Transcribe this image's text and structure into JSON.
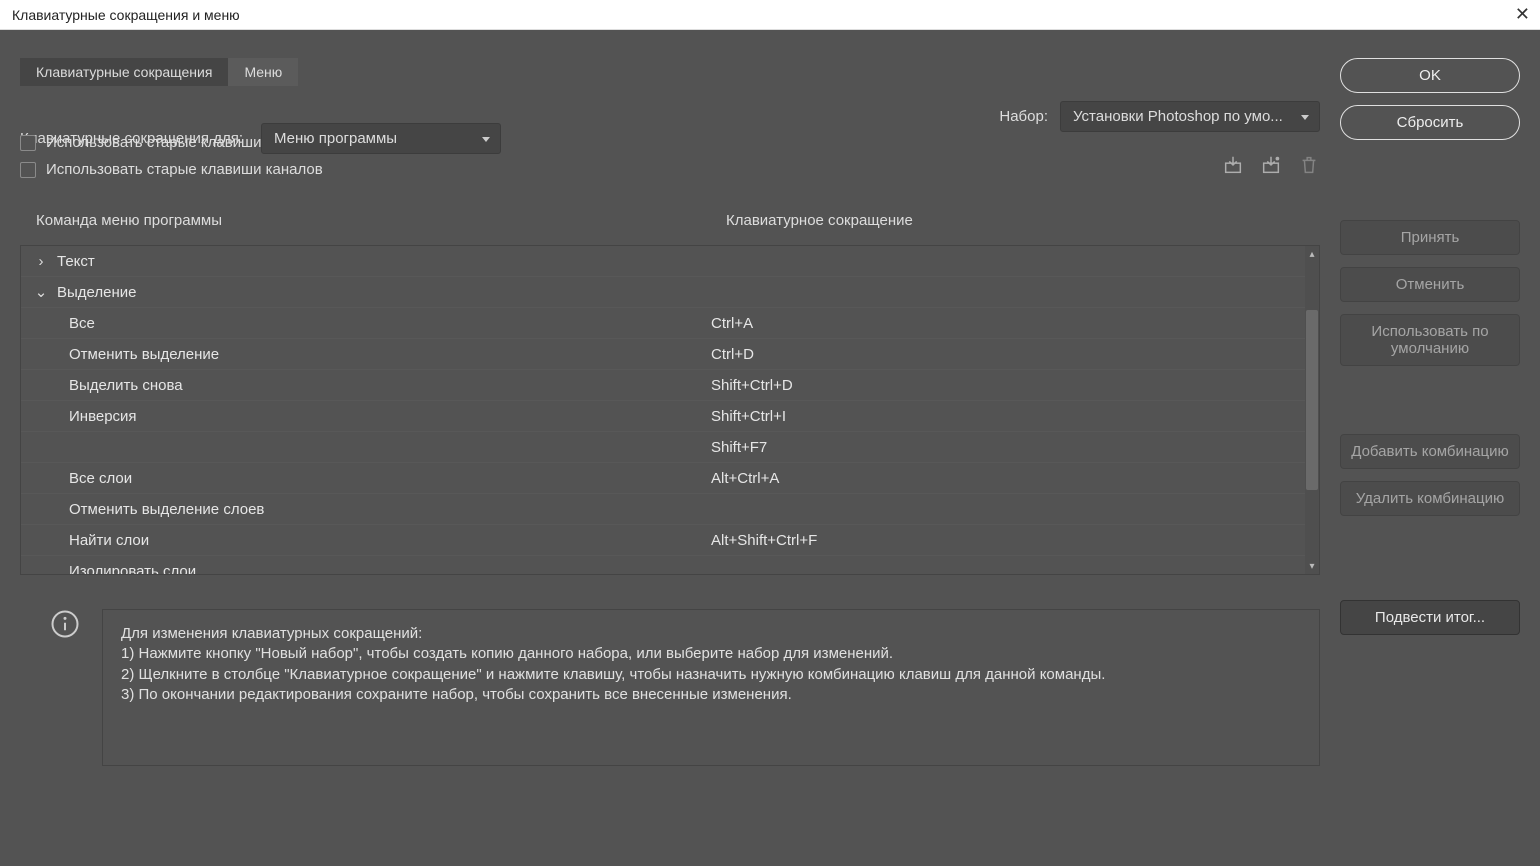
{
  "window": {
    "title": "Клавиатурные сокращения и меню"
  },
  "tabs": {
    "shortcuts": "Клавиатурные сокращения",
    "menus": "Меню"
  },
  "controls": {
    "shortcuts_for_label": "Клавиатурные сокращения для:",
    "shortcuts_for_value": "Меню программы",
    "set_label": "Набор:",
    "set_value": "Установки Photoshop по умо...",
    "legacy_undo": "Использовать старые клавиши для операции отмены",
    "legacy_channels": "Использовать старые клавиши каналов"
  },
  "table": {
    "header_cmd": "Команда меню программы",
    "header_shortcut": "Клавиатурное сокращение",
    "rows": [
      {
        "type": "group",
        "expanded": false,
        "label": "Текст",
        "shortcut": ""
      },
      {
        "type": "group",
        "expanded": true,
        "label": "Выделение",
        "shortcut": ""
      },
      {
        "type": "item",
        "label": "Все",
        "shortcut": "Ctrl+A"
      },
      {
        "type": "item",
        "label": "Отменить выделение",
        "shortcut": "Ctrl+D"
      },
      {
        "type": "item",
        "label": "Выделить снова",
        "shortcut": "Shift+Ctrl+D"
      },
      {
        "type": "item",
        "label": "Инверсия",
        "shortcut": "Shift+Ctrl+I"
      },
      {
        "type": "item",
        "label": "",
        "shortcut": "Shift+F7"
      },
      {
        "type": "item",
        "label": "Все слои",
        "shortcut": "Alt+Ctrl+A"
      },
      {
        "type": "item",
        "label": "Отменить выделение слоев",
        "shortcut": ""
      },
      {
        "type": "item",
        "label": "Найти слои",
        "shortcut": "Alt+Shift+Ctrl+F"
      },
      {
        "type": "item",
        "label": "Изолировать слои",
        "shortcut": ""
      }
    ]
  },
  "sidebuttons": {
    "accept": "Принять",
    "cancel": "Отменить",
    "use_default": "Использовать по умолчанию",
    "add": "Добавить комбинацию",
    "remove": "Удалить комбинацию",
    "summarize": "Подвести итог..."
  },
  "main_buttons": {
    "ok": "OK",
    "reset": "Сбросить"
  },
  "info": {
    "l1": "Для изменения клавиатурных сокращений:",
    "l2": "1) Нажмите кнопку \"Новый набор\", чтобы создать копию данного набора, или выберите набор для изменений.",
    "l3": "2) Щелкните в столбце \"Клавиатурное сокращение\" и нажмите клавишу, чтобы назначить нужную комбинацию клавиш для данной команды.",
    "l4": "3) По окончании редактирования сохраните набор, чтобы сохранить все внесенные изменения."
  }
}
